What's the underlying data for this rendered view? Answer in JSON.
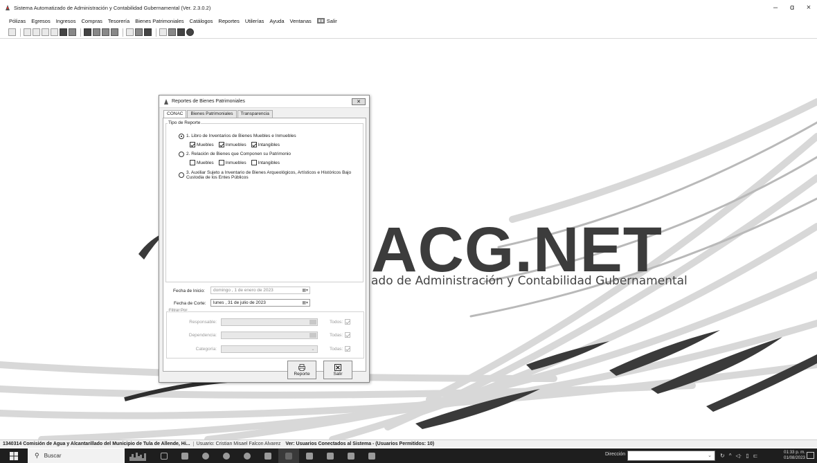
{
  "window": {
    "title": "Sistema Automatizado de Administración y Contabilidad Gubernamental  (Ver. 2.3.0.2)",
    "controls": [
      "–",
      "ɑ",
      "×"
    ]
  },
  "menu": [
    "Pólizas",
    "Egresos",
    "Ingresos",
    "Compras",
    "Tesorería",
    "Bienes Patrimoniales",
    "Catálogos",
    "Reportes",
    "Utilerías",
    "Ayuda",
    "Ventanas"
  ],
  "menu_exit": "Salir",
  "background": {
    "logo": "ACG.NET",
    "subtitle": "ado de Administración y Contabilidad Gubernamental"
  },
  "dialog": {
    "title": "Reportes de Bienes Patrimoniales",
    "tabs": [
      "CONAC",
      "Bienes Patrimoniales",
      "Transparencia"
    ],
    "active_tab": "CONAC",
    "group_label": "Tipo de Reporte",
    "options": [
      {
        "label": "1.  Libro de Inventarios de Bienes Muebles e Inmuebles",
        "selected": true
      },
      {
        "label": "2.  Relación de Bienes que Componen su Patrimonio",
        "selected": false
      },
      {
        "label": "3.  Auxiliar Sujeto a Inventario de Bienes Arqueológicos, Artísticos e Históricos Bajo Custodia de los Entes Públicos",
        "selected": false
      }
    ],
    "checks_1": [
      {
        "label": "Muebles",
        "checked": true
      },
      {
        "label": "Inmuebles",
        "checked": true
      },
      {
        "label": "Intangibles",
        "checked": true
      }
    ],
    "checks_2": [
      {
        "label": "Muebles",
        "checked": false
      },
      {
        "label": "Inmuebles",
        "checked": false
      },
      {
        "label": "Intangibles",
        "checked": false
      }
    ],
    "start_label": "Fecha de Inicio:",
    "start_value": "domingo ,   1 de    enero    de 2023",
    "end_label": "Fecha de Corte:",
    "end_value": "lunes   , 31 de    julio    de 2023",
    "filter_label": "Filtrar Por",
    "filters": [
      {
        "label": "Responsable:",
        "todos": "Todos:"
      },
      {
        "label": "Dependencia:",
        "todos": "Todas:"
      },
      {
        "label": "Categoría:",
        "todos": "Todas:"
      }
    ],
    "btn_report": "Reporte",
    "btn_exit": "Salir"
  },
  "status": {
    "org": "1340314 Comisión de Agua y Alcantarillado del Municipio de Tula de Allende, Hi...",
    "user": "Usuario: Cristian Misael Falcon Alvarez",
    "connected": "Ver: Usuarios Conectados al Sistema - (Usuarios Permitidos: 10)"
  },
  "taskbar": {
    "search": "Buscar",
    "direccion": "Dirección",
    "time": "01:33 p. m.",
    "date": "01/08/2023"
  }
}
